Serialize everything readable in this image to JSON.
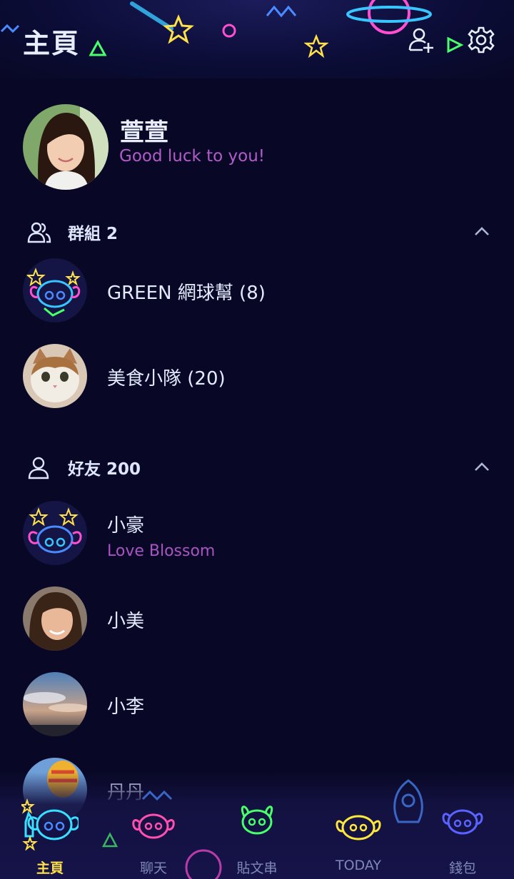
{
  "header": {
    "title": "主頁",
    "icons": [
      "add-friend-icon",
      "settings-icon"
    ]
  },
  "profile": {
    "name": "萱萱",
    "status": "Good luck to you!"
  },
  "groups_section": {
    "label": "群組 2",
    "icon": "group-icon",
    "state": "expanded"
  },
  "groups": [
    {
      "name": "GREEN 網球幫 (8)",
      "avatar": "stitch-neon-avatar"
    },
    {
      "name": "美食小隊 (20)",
      "avatar": "cat-photo-avatar"
    }
  ],
  "friends_section": {
    "label": "好友 200",
    "icon": "person-icon",
    "state": "expanded"
  },
  "friends": [
    {
      "name": "小豪",
      "status": "Love Blossom",
      "avatar": "stitch-neon-avatar"
    },
    {
      "name": "小美",
      "status": "",
      "avatar": "woman-photo-avatar"
    },
    {
      "name": "小李",
      "status": "",
      "avatar": "sky-photo-avatar"
    },
    {
      "name": "丹丹",
      "status": "",
      "avatar": "balloon-photo-avatar"
    }
  ],
  "tabs": [
    {
      "label": "主頁",
      "active": true,
      "color": "#39e0ff"
    },
    {
      "label": "聊天",
      "active": false,
      "color": "#ff4fb0"
    },
    {
      "label": "貼文串",
      "active": false,
      "color": "#49ff6a"
    },
    {
      "label": "TODAY",
      "active": false,
      "color": "#ffe83d"
    },
    {
      "label": "錢包",
      "active": false,
      "color": "#5a63ff"
    }
  ],
  "colors": {
    "background": "#080826",
    "accent_active": "#ffe14a",
    "status_text": "#b25cc7"
  }
}
